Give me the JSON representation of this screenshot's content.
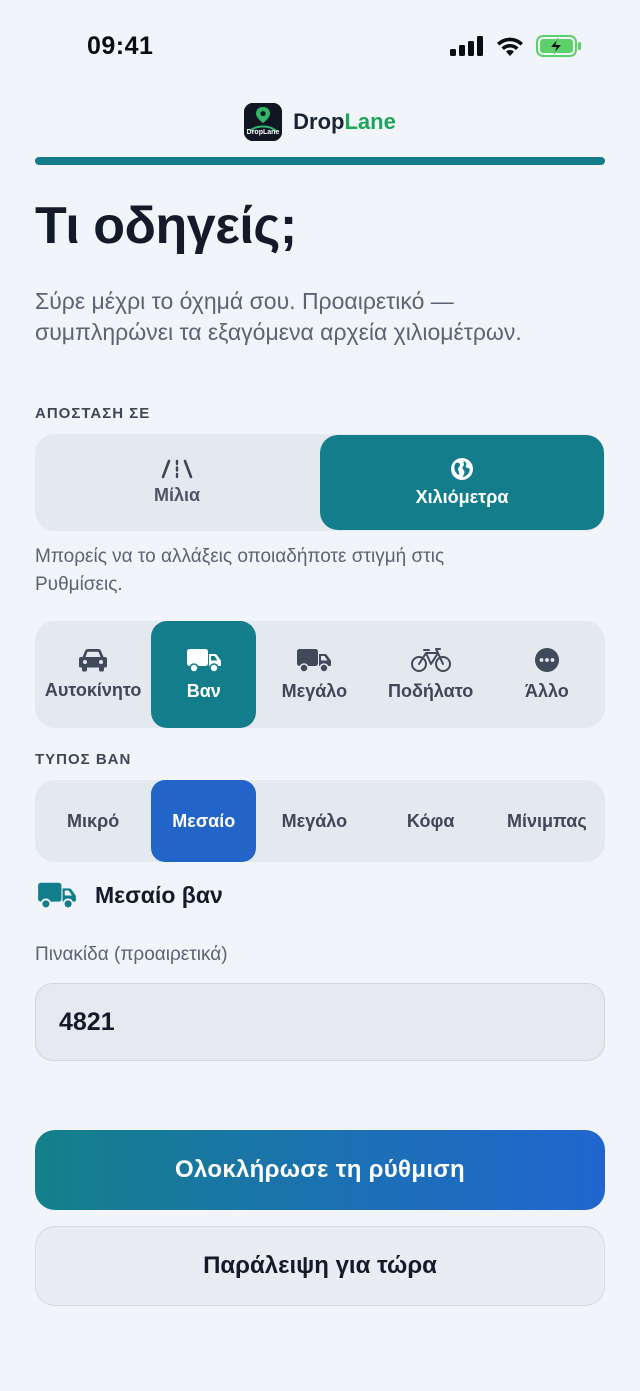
{
  "status_bar": {
    "time": "09:41"
  },
  "brand": {
    "name_part1": "Drop",
    "name_part2": "Lane",
    "logo_text": "Drop Lane"
  },
  "page": {
    "title": "Τι οδηγείς;",
    "subtitle": "Σύρε μέχρι το όχημά σου. Προαιρετικό — συμπληρώνει τα εξαγόμενα αρχεία χιλιομέτρων."
  },
  "distance": {
    "section_label": "ΑΠΟΣΤΑΣΗ ΣΕ",
    "options": [
      {
        "label": "Μίλια",
        "icon": "road-icon",
        "selected": false
      },
      {
        "label": "Χιλιόμετρα",
        "icon": "globe-icon",
        "selected": true
      }
    ],
    "hint": "Μπορείς να το αλλάξεις οποιαδήποτε στιγμή στις Ρυθμίσεις."
  },
  "vehicle": {
    "options": [
      {
        "label": "Αυτοκίνητο",
        "icon": "car-icon",
        "selected": false
      },
      {
        "label": "Βαν",
        "icon": "van-icon",
        "selected": true
      },
      {
        "label": "Μεγάλο",
        "icon": "truck-icon",
        "selected": false
      },
      {
        "label": "Ποδήλατο",
        "icon": "bicycle-icon",
        "selected": false
      },
      {
        "label": "Άλλο",
        "icon": "more-icon",
        "selected": false
      }
    ]
  },
  "van_type": {
    "section_label": "ΤΥΠΟΣ ΒΑΝ",
    "options": [
      {
        "label": "Μικρό",
        "selected": false
      },
      {
        "label": "Μεσαίο",
        "selected": true
      },
      {
        "label": "Μεγάλο",
        "selected": false
      },
      {
        "label": "Κόφα",
        "selected": false
      },
      {
        "label": "Μίνιμπας",
        "selected": false
      }
    ],
    "selected_summary": "Μεσαίο βαν"
  },
  "plate": {
    "label": "Πινακίδα (προαιρετικά)",
    "value": "4821"
  },
  "actions": {
    "finish_label": "Ολοκλήρωσε τη ρύθμιση",
    "skip_label": "Παράλειψη για τώρα"
  },
  "colors": {
    "accent_teal": "#147d8b",
    "accent_blue": "#2264c8",
    "brand_green": "#1fa35a",
    "background": "#f1f4f9"
  }
}
